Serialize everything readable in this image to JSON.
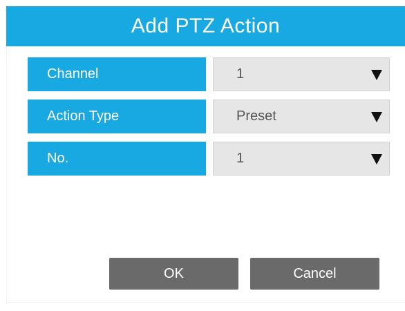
{
  "dialog": {
    "title": "Add PTZ Action"
  },
  "fields": [
    {
      "label": "Channel",
      "value": "1"
    },
    {
      "label": "Action Type",
      "value": "Preset"
    },
    {
      "label": "No.",
      "value": "1"
    }
  ],
  "buttons": {
    "ok": "OK",
    "cancel": "Cancel"
  },
  "icons": {
    "dropdown": "chevron-down-icon"
  },
  "colors": {
    "accent": "#19a9e2",
    "button": "#6a6a6a",
    "select_bg": "#e6e6e6"
  }
}
